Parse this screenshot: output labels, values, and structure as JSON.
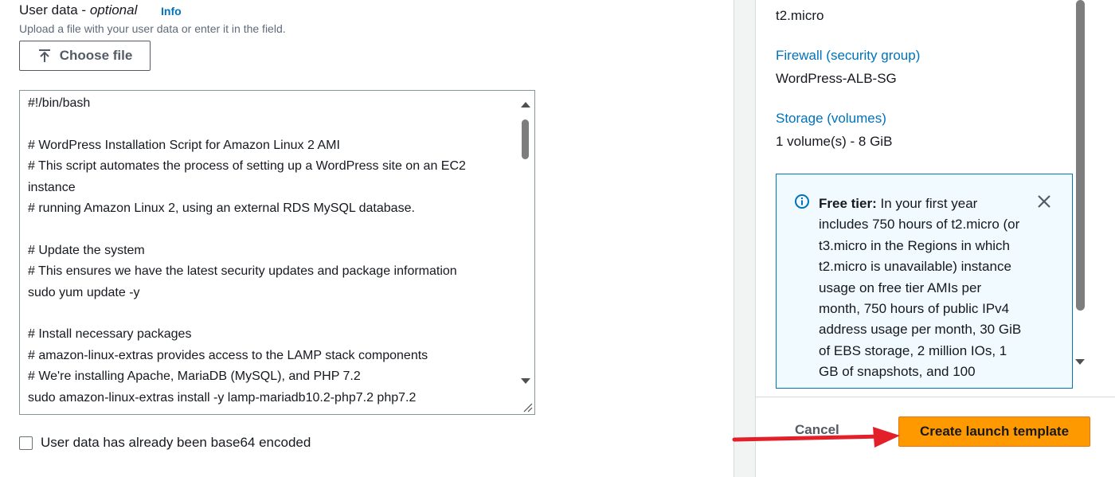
{
  "user_data": {
    "label": "User data - ",
    "label_optional": "optional",
    "info": "Info",
    "description": "Upload a file with your user data or enter it in the field.",
    "choose_file": "Choose file",
    "script_lines": [
      "#!/bin/bash",
      "",
      "# WordPress Installation Script for Amazon Linux 2 AMI",
      "# This script automates the process of setting up a WordPress site on an EC2",
      "instance",
      "# running Amazon Linux 2, using an external RDS MySQL database.",
      "",
      "# Update the system",
      "# This ensures we have the latest security updates and package information",
      "sudo yum update -y",
      "",
      "# Install necessary packages",
      "# amazon-linux-extras provides access to the LAMP stack components",
      "# We're installing Apache, MariaDB (MySQL), and PHP 7.2",
      "sudo amazon-linux-extras install -y lamp-mariadb10.2-php7.2 php7.2"
    ],
    "base64_label": "User data has already been base64 encoded",
    "base64_checked": false
  },
  "summary": {
    "instance_type_value": "t2.micro",
    "firewall_label": "Firewall (security group)",
    "firewall_value": "WordPress-ALB-SG",
    "storage_label": "Storage (volumes)",
    "storage_value": "1 volume(s) - 8 GiB",
    "free_tier": {
      "title": "Free tier:",
      "text": " In your first year includes 750 hours of t2.micro (or t3.micro in the Regions in which t2.micro is unavailable) instance usage on free tier AMIs per month, 750 hours of public IPv4 address usage per month, 30 GiB of EBS storage, 2 million IOs, 1 GB of snapshots, and 100"
    }
  },
  "actions": {
    "cancel": "Cancel",
    "create": "Create launch template"
  },
  "colors": {
    "link": "#0073bb",
    "primary": "#ff9900",
    "annotation_arrow": "#e3202a"
  }
}
